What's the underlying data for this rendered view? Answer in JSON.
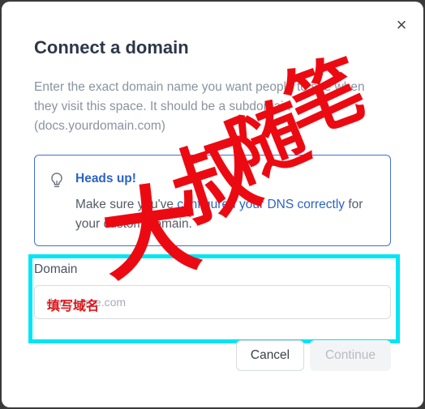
{
  "dialog": {
    "close_symbol": "×",
    "title": "Connect a domain",
    "description": "Enter the exact domain name you want people to see when they visit this space. It should be a subdomain (docs.yourdomain.com)"
  },
  "alert": {
    "icon": "lightbulb-icon",
    "title": "Heads up!",
    "body_before": "Make sure you've ",
    "link_text": "configured your DNS correctly",
    "body_after": " for your custom domain.",
    "accent_color": "#2b62c8"
  },
  "form": {
    "label": "Domain",
    "placeholder": "docs.acme.com",
    "value": ""
  },
  "actions": {
    "cancel_label": "Cancel",
    "continue_label": "Continue"
  },
  "annotations": {
    "highlight_color": "#00e5f5",
    "input_note": "填写域名",
    "watermark_text": "大叔随笔",
    "watermark_color": "#ec0a12"
  }
}
